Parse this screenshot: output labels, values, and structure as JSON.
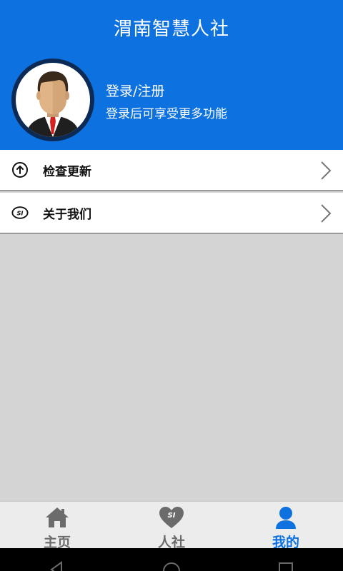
{
  "header": {
    "title": "渭南智慧人社",
    "bg_color": "#0d72e0"
  },
  "profile": {
    "avatar_icon": "user-avatar-icon",
    "login_label": "登录/注册",
    "login_hint": "登录后可享受更多功能"
  },
  "menu": [
    {
      "label": "检查更新",
      "icon": "arrow-up-circle-icon"
    },
    {
      "label": "关于我们",
      "icon": "si-logo-icon"
    }
  ],
  "bottom_nav": [
    {
      "label": "主页",
      "icon": "home-icon",
      "active": false
    },
    {
      "label": "人社",
      "icon": "heart-si-icon",
      "active": false
    },
    {
      "label": "我的",
      "icon": "person-icon",
      "active": true
    }
  ],
  "colors": {
    "accent": "#0d72e0",
    "inactive": "#6b6b6b",
    "content_bg": "#d4d4d4"
  },
  "system_bar": {
    "buttons": [
      "back-icon",
      "home-circle-icon",
      "recents-icon"
    ]
  }
}
